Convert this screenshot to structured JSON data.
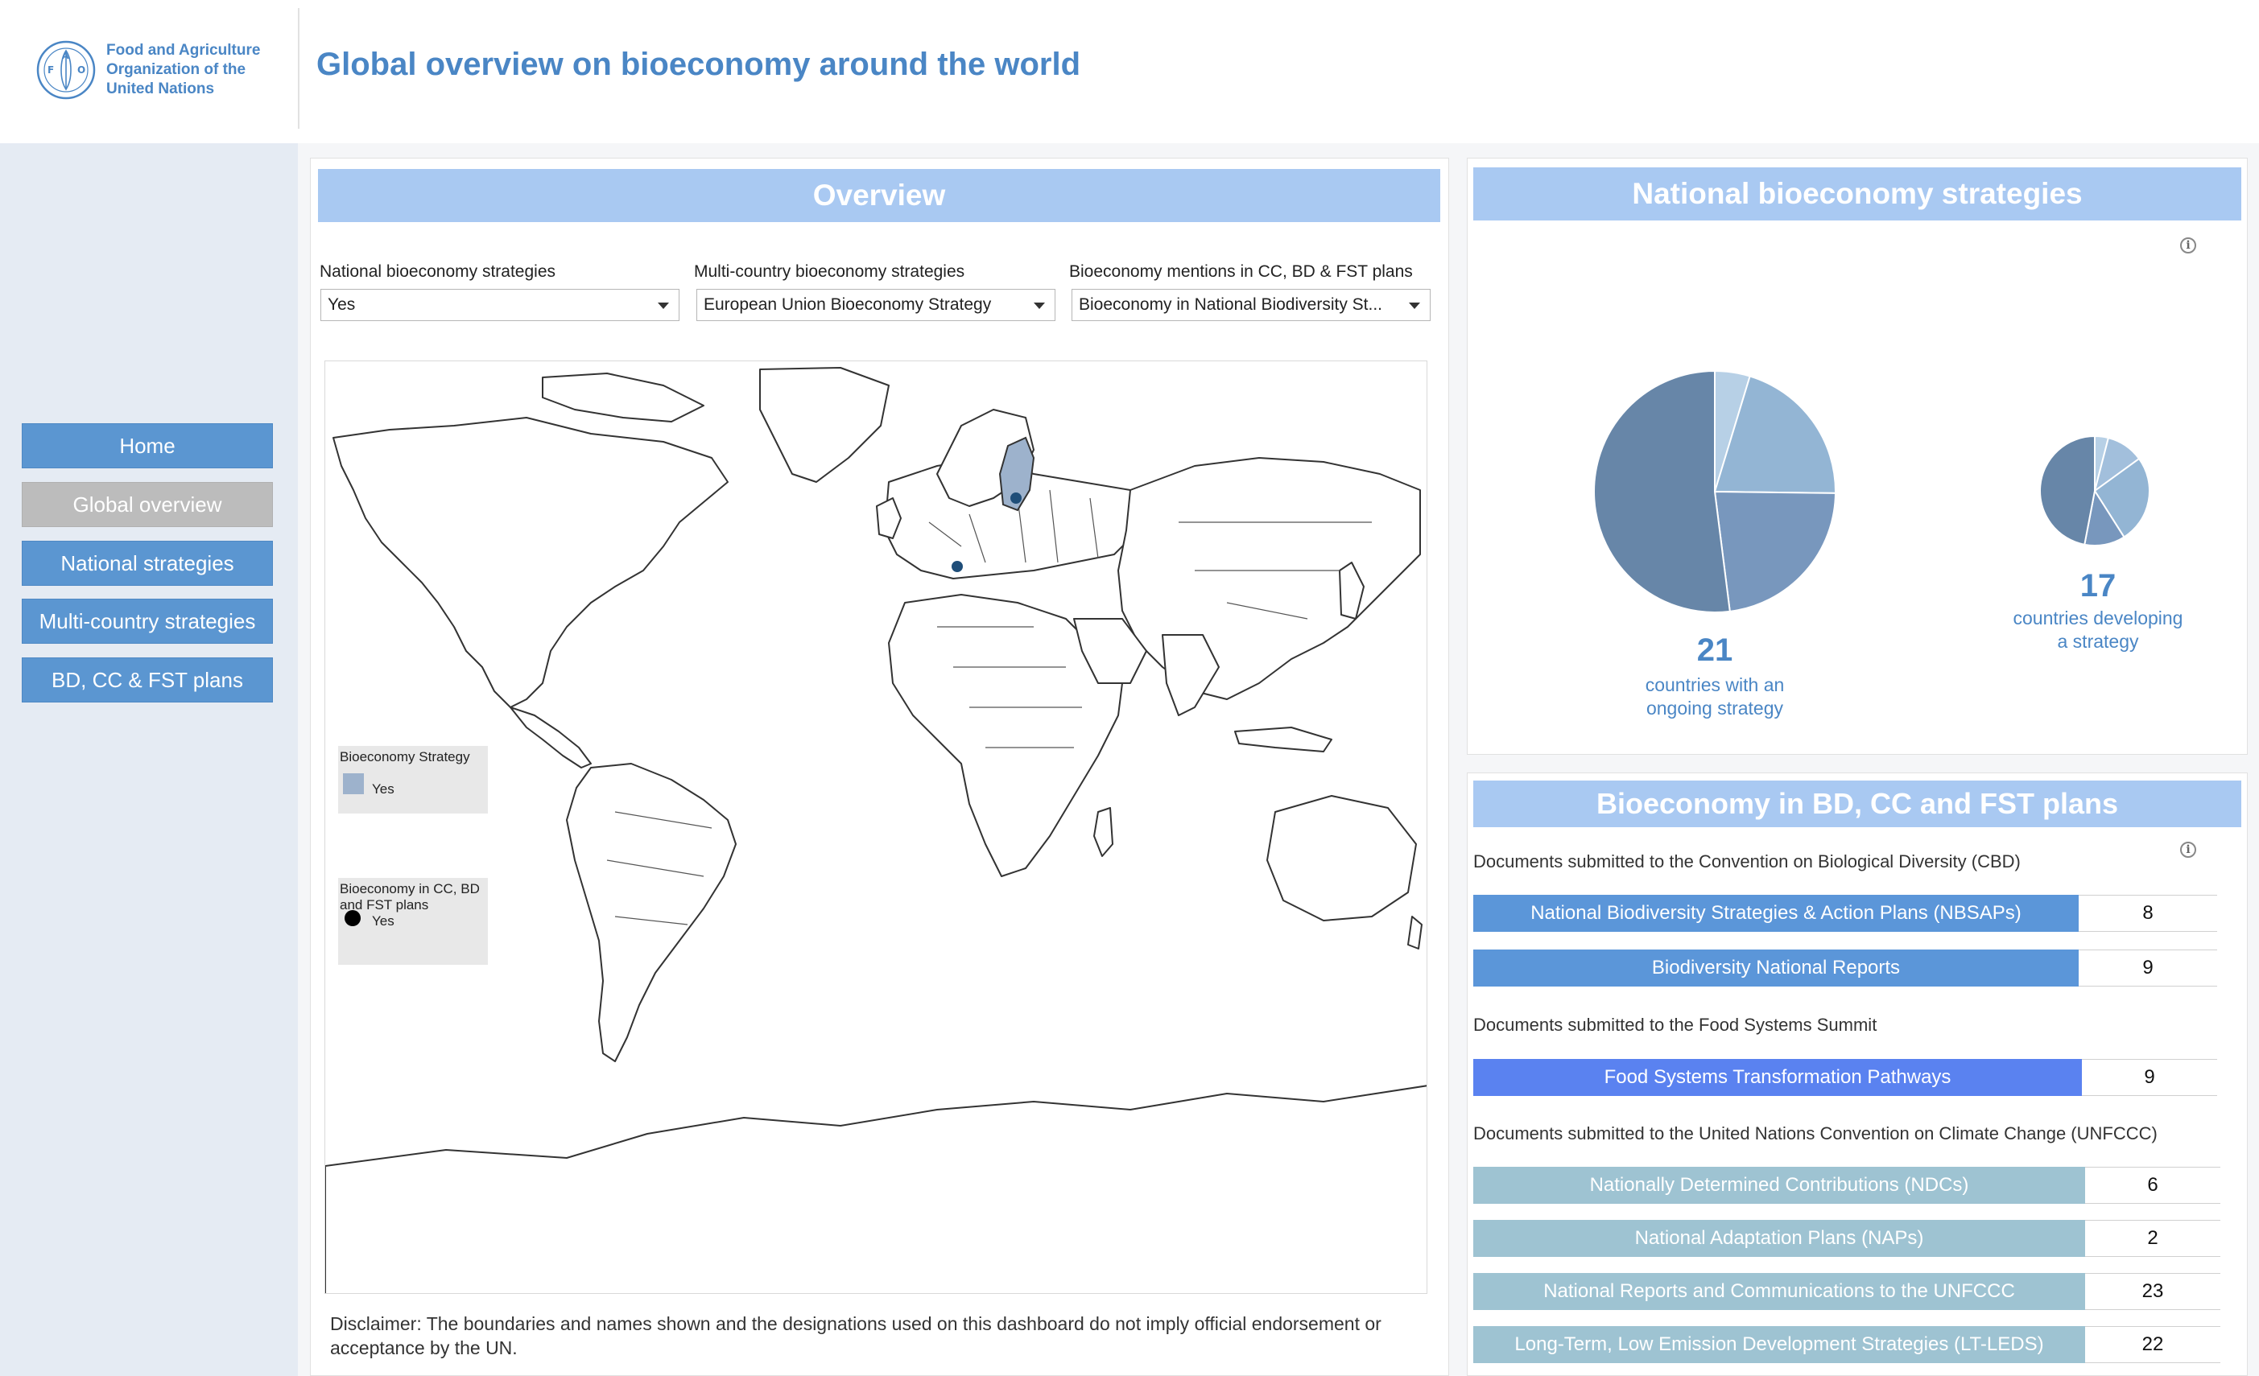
{
  "header": {
    "org_line1": "Food and Agriculture",
    "org_line2": "Organization of the",
    "org_line3": "United Nations",
    "title": "Global overview on bioeconomy around the world"
  },
  "sidebar": {
    "items": [
      {
        "label": "Home",
        "active": false
      },
      {
        "label": "Global overview",
        "active": true
      },
      {
        "label": "National strategies",
        "active": false
      },
      {
        "label": "Multi-country strategies",
        "active": false
      },
      {
        "label": "BD, CC & FST plans",
        "active": false
      }
    ]
  },
  "overview": {
    "title": "Overview",
    "filters": [
      {
        "label": "National bioeconomy strategies",
        "value": "Yes"
      },
      {
        "label": "Multi-country bioeconomy strategies",
        "value": "European Union Bioeconomy Strategy"
      },
      {
        "label": "Bioeconomy mentions in CC, BD & FST plans",
        "value": "Bioeconomy in National Biodiversity St..."
      }
    ],
    "legend": {
      "strategy_title": "Bioeconomy Strategy",
      "strategy_item": "Yes",
      "plans_title": "Bioeconomy in CC, BD and FST plans",
      "plans_item": "Yes"
    },
    "disclaimer": "Disclaimer: The boundaries and names shown and the designations used on this dashboard do not imply official endorsement or acceptance by the UN."
  },
  "national": {
    "title": "National bioeconomy strategies",
    "info_icon": "info-icon",
    "ongoing_count": "21",
    "ongoing_desc_1": "countries with an",
    "ongoing_desc_2": "ongoing strategy",
    "developing_count": "17",
    "developing_desc_1": "countries developing",
    "developing_desc_2": "a strategy"
  },
  "chart_data": [
    {
      "type": "pie",
      "values": [
        0.047,
        0.205,
        0.228,
        0.52
      ],
      "colors": [
        "#b7d0e6",
        "#93b5d4",
        "#7897bd",
        "#6786a8"
      ]
    },
    {
      "type": "pie",
      "values": [
        0.04,
        0.11,
        0.26,
        0.12,
        0.47
      ],
      "colors": [
        "#b7d0e6",
        "#a2bfdc",
        "#93b5d4",
        "#7897bd",
        "#6786a8"
      ]
    }
  ],
  "plans": {
    "title": "Bioeconomy in BD, CC and FST plans",
    "groups": [
      {
        "label": "Documents submitted to the Convention on Biological Diversity (CBD)",
        "color": "#5b96d9",
        "rows": [
          {
            "label": "National Biodiversity Strategies & Action Plans (NBSAPs)",
            "value": "8"
          },
          {
            "label": "Biodiversity National Reports",
            "value": "9"
          }
        ]
      },
      {
        "label": "Documents submitted to the Food Systems Summit",
        "color": "#5a82f0",
        "rows": [
          {
            "label": "Food Systems Transformation Pathways",
            "value": "9"
          }
        ]
      },
      {
        "label": "Documents submitted to the United Nations Convention on Climate Change (UNFCCC)",
        "color": "#9ec3d2",
        "rows": [
          {
            "label": "Nationally Determined Contributions (NDCs)",
            "value": "6"
          },
          {
            "label": "National Adaptation Plans (NAPs)",
            "value": "2"
          },
          {
            "label": "National Reports and Communications to the UNFCCC",
            "value": "23"
          },
          {
            "label": "Long-Term, Low Emission Development Strategies (LT-LEDS)",
            "value": "22"
          }
        ]
      }
    ]
  }
}
